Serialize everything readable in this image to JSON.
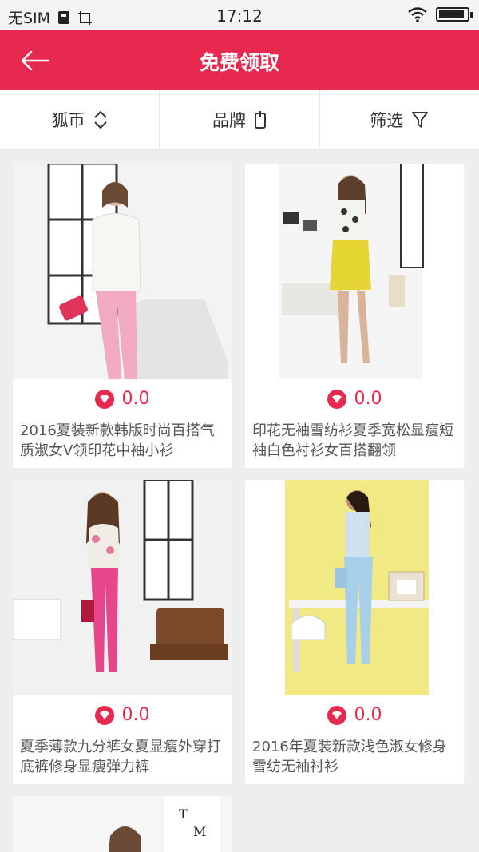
{
  "status": {
    "carrier": "无SIM",
    "time": "17:12",
    "battery_level": 0.9
  },
  "header": {
    "title": "免费领取"
  },
  "filters": [
    {
      "label": "狐币",
      "icon": "sort-updown-icon"
    },
    {
      "label": "品牌",
      "icon": "tag-icon"
    },
    {
      "label": "筛选",
      "icon": "funnel-icon"
    }
  ],
  "products": [
    {
      "price": "0.0",
      "title": "2016夏装新款韩版时尚百搭气质淑女V领印花中袖小衫"
    },
    {
      "price": "0.0",
      "title": "印花无袖雪纺衫夏季宽松显瘦短袖白色衬衫女百搭翻领"
    },
    {
      "price": "0.0",
      "title": "夏季薄款九分裤女夏显瘦外穿打底裤修身显瘦弹力裤"
    },
    {
      "price": "0.0",
      "title": "2016年夏装新款浅色淑女修身雪纺无袖衬衫"
    },
    {
      "price": "",
      "title": ""
    }
  ],
  "colors": {
    "accent": "#e8294f"
  }
}
